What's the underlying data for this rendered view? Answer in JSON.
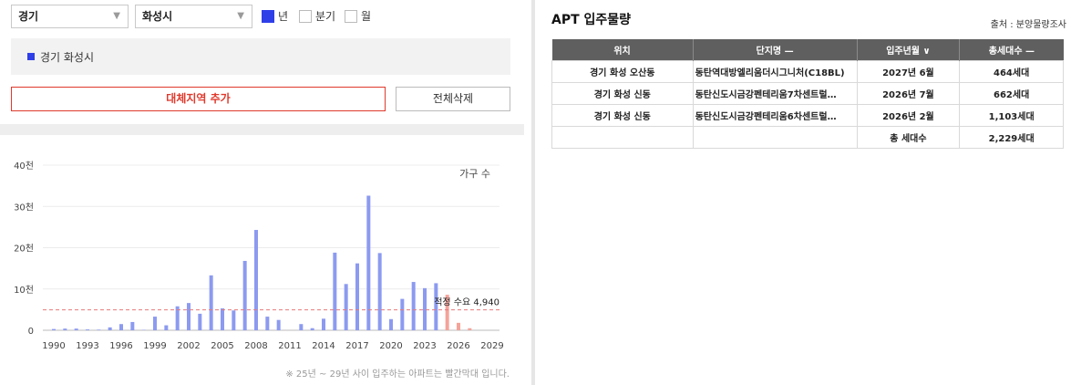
{
  "filters": {
    "province": "경기",
    "city": "화성시",
    "periods": [
      {
        "label": "년",
        "checked": true
      },
      {
        "label": "분기",
        "checked": false
      },
      {
        "label": "월",
        "checked": false
      }
    ]
  },
  "selected_region": "경기 화성시",
  "buttons": {
    "add_region": "대체지역 추가",
    "delete_all": "전체삭제"
  },
  "chart_data": {
    "type": "bar",
    "series_label": "가구 수",
    "y_ticks": [
      "0",
      "10천",
      "20천",
      "30천",
      "40천"
    ],
    "x_ticks": [
      "1990",
      "1993",
      "1996",
      "1999",
      "2002",
      "2005",
      "2008",
      "2011",
      "2014",
      "2017",
      "2020",
      "2023",
      "2026",
      "2029"
    ],
    "x": [
      1990,
      1991,
      1992,
      1993,
      1994,
      1995,
      1996,
      1997,
      1998,
      1999,
      2000,
      2001,
      2002,
      2003,
      2004,
      2005,
      2006,
      2007,
      2008,
      2009,
      2010,
      2011,
      2012,
      2013,
      2014,
      2015,
      2016,
      2017,
      2018,
      2019,
      2020,
      2021,
      2022,
      2023,
      2024,
      2025,
      2026,
      2027
    ],
    "values": [
      300,
      400,
      400,
      200,
      150,
      700,
      1500,
      2000,
      100,
      3300,
      1200,
      5800,
      6600,
      4000,
      13300,
      5300,
      4800,
      16800,
      24300,
      3300,
      2500,
      0,
      1500,
      500,
      2800,
      18800,
      11200,
      16200,
      32600,
      18700,
      2700,
      7600,
      11700,
      10200,
      11400,
      8600,
      1800,
      500
    ],
    "highlight_from": 2025,
    "ylim": [
      0,
      40000
    ],
    "reference_line": {
      "value": 4940,
      "label": "적정 수요 4,940"
    },
    "colors": {
      "bar": "#8c9af0",
      "highlight": "#f4a39a",
      "reference": "#e87a7a"
    }
  },
  "note": "※ 25년 ~ 29년 사이 입주하는 아파트는 빨간막대 입니다.",
  "apt": {
    "title": "APT 입주물량",
    "source": "출처 : 분양물량조사",
    "headers": [
      "위치",
      "단지명 —",
      "입주년월 ∨",
      "총세대수 —"
    ],
    "rows": [
      [
        "경기 화성 오산동",
        "동탄역대방엘리움더시그니처(C18BL)",
        "2027년 6월",
        "464세대"
      ],
      [
        "경기 화성 신동",
        "동탄신도시금강펜테리움7차센트럴…",
        "2026년 7월",
        "662세대"
      ],
      [
        "경기 화성 신동",
        "동탄신도시금강펜테리움6차센트럴…",
        "2026년 2월",
        "1,103세대"
      ]
    ],
    "total_label": "총 세대수",
    "total_value": "2,229세대"
  }
}
